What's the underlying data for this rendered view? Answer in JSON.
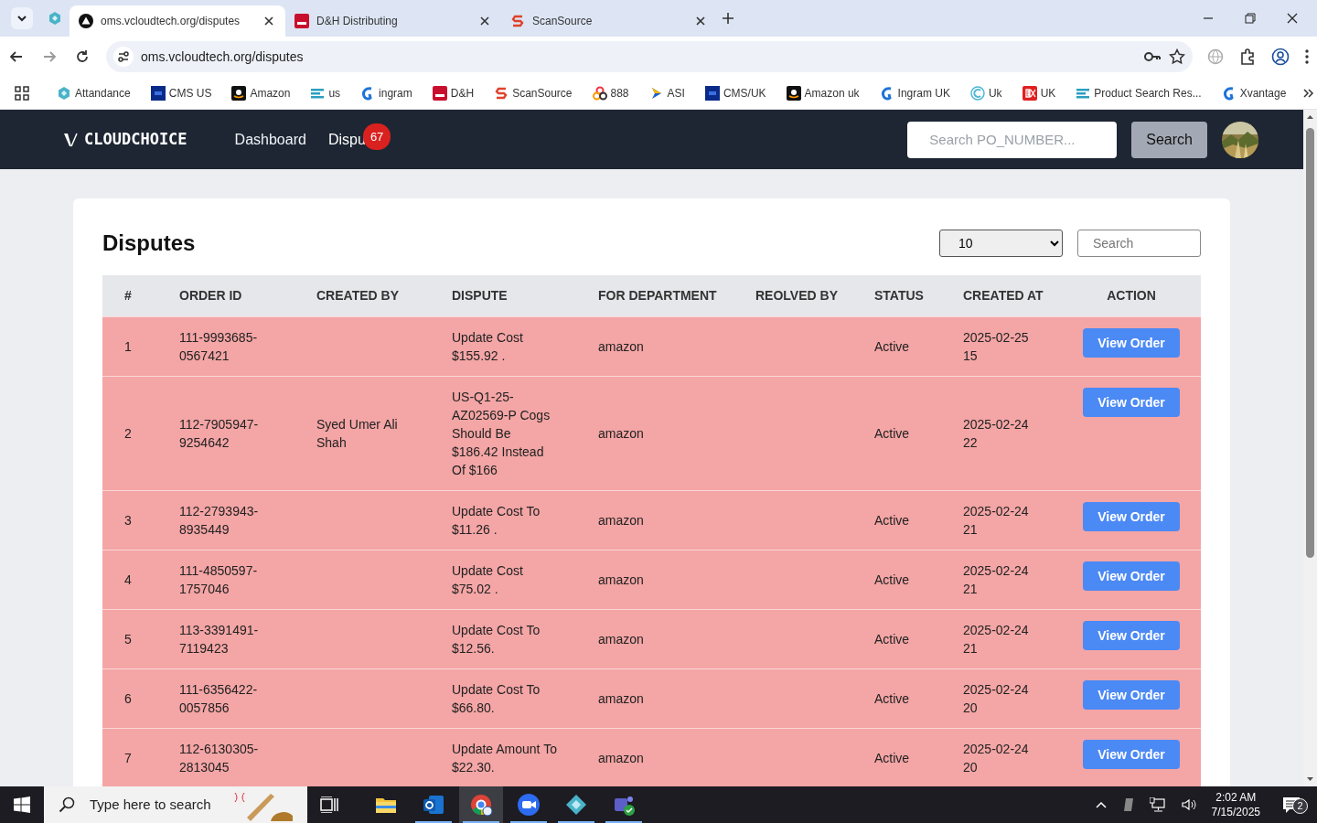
{
  "browser": {
    "tabs": [
      {
        "title": "oms.vcloudtech.org/disputes",
        "kind": "triangle",
        "selected": true
      },
      {
        "title": "D&H Distributing",
        "kind": "dh",
        "selected": false
      },
      {
        "title": "ScanSource",
        "kind": "scansource",
        "selected": false
      }
    ],
    "address": "oms.vcloudtech.org/disputes",
    "bookmarks": [
      {
        "label": "Attandance",
        "kind": "hex"
      },
      {
        "label": "CMS US",
        "kind": "df"
      },
      {
        "label": "Amazon",
        "kind": "amazon"
      },
      {
        "label": "us",
        "kind": "ec"
      },
      {
        "label": "ingram",
        "kind": "ingram"
      },
      {
        "label": "D&H",
        "kind": "dh"
      },
      {
        "label": "ScanSource",
        "kind": "scansource"
      },
      {
        "label": "888",
        "kind": "rings"
      },
      {
        "label": "ASI",
        "kind": "asi"
      },
      {
        "label": "CMS/UK",
        "kind": "df"
      },
      {
        "label": "Amazon uk",
        "kind": "amazon"
      },
      {
        "label": "Ingram UK",
        "kind": "ingram"
      },
      {
        "label": "Uk",
        "kind": "c"
      },
      {
        "label": "UK",
        "kind": "ex"
      },
      {
        "label": "Product Search Res...",
        "kind": "ec"
      },
      {
        "label": "Xvantage",
        "kind": "ingram"
      }
    ]
  },
  "navbar": {
    "brand": "CLOUDCHOICE",
    "links": [
      {
        "label": "Dashboard",
        "selected": false
      },
      {
        "label": "Dispu",
        "selected": true,
        "badge": "67"
      }
    ],
    "search": {
      "placeholder": "Search PO_NUMBER..."
    },
    "search_button": "Search"
  },
  "page": {
    "title": "Disputes",
    "page_size": "10",
    "search": {
      "placeholder": "Search"
    },
    "table": {
      "columns": [
        "#",
        "ORDER ID",
        "CREATED BY",
        "DISPUTE",
        "FOR DEPARTMENT",
        "REOLVED BY",
        "STATUS",
        "CREATED AT",
        "ACTION"
      ],
      "rows": [
        {
          "num": "1",
          "order_id": "111-9993685-0567421",
          "created_by": "",
          "dispute": "Update Cost $155.92 .",
          "department": "amazon",
          "resolved_by": "",
          "status": "Active",
          "created_at": "2025-02-25 15",
          "action": "View Order"
        },
        {
          "num": "2",
          "order_id": "112-7905947-9254642",
          "created_by": "Syed Umer Ali Shah",
          "dispute": "US-Q1-25-AZ02569-P Cogs Should Be $186.42 Instead Of $166",
          "department": "amazon",
          "resolved_by": "",
          "status": "Active",
          "created_at": "2025-02-24 22",
          "action": "View Order"
        },
        {
          "num": "3",
          "order_id": "112-2793943-8935449",
          "created_by": "",
          "dispute": "Update Cost To $11.26 .",
          "department": "amazon",
          "resolved_by": "",
          "status": "Active",
          "created_at": "2025-02-24 21",
          "action": "View Order"
        },
        {
          "num": "4",
          "order_id": "111-4850597-1757046",
          "created_by": "",
          "dispute": "Update Cost $75.02 .",
          "department": "amazon",
          "resolved_by": "",
          "status": "Active",
          "created_at": "2025-02-24 21",
          "action": "View Order"
        },
        {
          "num": "5",
          "order_id": "113-3391491-7119423",
          "created_by": "",
          "dispute": "Update Cost To $12.56.",
          "department": "amazon",
          "resolved_by": "",
          "status": "Active",
          "created_at": "2025-02-24 21",
          "action": "View Order"
        },
        {
          "num": "6",
          "order_id": "111-6356422-0057856",
          "created_by": "",
          "dispute": "Update Cost To $66.80.",
          "department": "amazon",
          "resolved_by": "",
          "status": "Active",
          "created_at": "2025-02-24 20",
          "action": "View Order"
        },
        {
          "num": "7",
          "order_id": "112-6130305-2813045",
          "created_by": "",
          "dispute": "Update Amount To $22.30.",
          "department": "amazon",
          "resolved_by": "",
          "status": "Active",
          "created_at": "2025-02-24 20",
          "action": "View Order"
        }
      ]
    }
  },
  "taskbar": {
    "search": {
      "placeholder": "Type here to search"
    },
    "apps": [
      {
        "kind": "explorer",
        "running": false,
        "selected": false
      },
      {
        "kind": "outlook",
        "running": true,
        "selected": false
      },
      {
        "kind": "chrome",
        "running": true,
        "selected": true
      },
      {
        "kind": "zoom",
        "running": true,
        "selected": false
      },
      {
        "kind": "diamond",
        "running": true,
        "selected": false
      },
      {
        "kind": "teams",
        "running": true,
        "selected": false
      }
    ],
    "time": "2:02 AM",
    "date": "7/15/2025",
    "notifications": "2"
  }
}
